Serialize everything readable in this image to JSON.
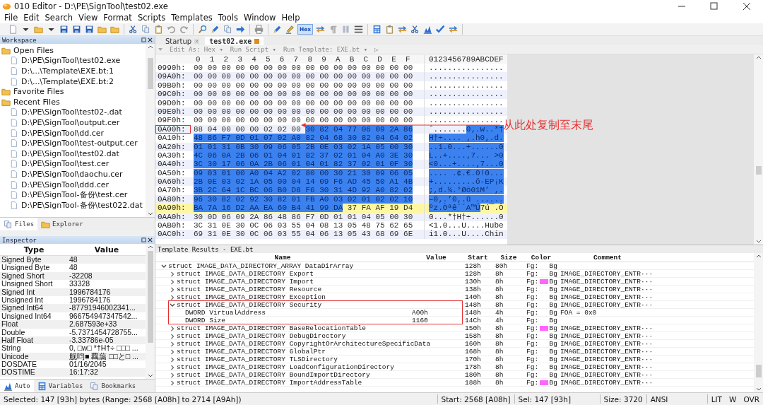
{
  "window": {
    "title": "010 Editor - D:\\PE\\SignTool\\test02.exe"
  },
  "menu": [
    "File",
    "Edit",
    "Search",
    "View",
    "Format",
    "Scripts",
    "Templates",
    "Tools",
    "Window",
    "Help"
  ],
  "toolbar": [
    [
      {
        "kind": "page"
      },
      {
        "kind": "caret"
      },
      {
        "kind": "folder"
      },
      {
        "kind": "caret"
      },
      {
        "kind": "disk"
      },
      {
        "kind": "disk"
      },
      {
        "kind": "disk"
      },
      {
        "kind": "folder"
      },
      {
        "kind": "folder"
      }
    ],
    [
      {
        "kind": "scissors"
      },
      {
        "kind": "pages"
      },
      {
        "kind": "clipboard"
      },
      {
        "kind": "undo"
      },
      {
        "kind": "redo"
      }
    ],
    [
      {
        "kind": "search"
      },
      {
        "kind": "pen"
      },
      {
        "kind": "pages"
      },
      {
        "kind": "arrow"
      }
    ],
    [
      {
        "kind": "printer"
      }
    ],
    [
      {
        "kind": "pen"
      },
      {
        "kind": "highlighter"
      },
      {
        "kind": "text",
        "label": "Hex",
        "selected": true
      },
      {
        "kind": "arrows"
      },
      {
        "kind": "paragraph"
      },
      {
        "kind": "columns"
      },
      {
        "kind": "grid"
      }
    ],
    [
      {
        "kind": "calculator"
      },
      {
        "kind": "clipboard"
      },
      {
        "kind": "arrows"
      },
      {
        "kind": "scissors"
      },
      {
        "kind": "chart"
      },
      {
        "kind": "check"
      },
      {
        "kind": "arrows"
      }
    ]
  ],
  "workspace": {
    "title": "Workspace",
    "groups": [
      {
        "label": "Open Files",
        "children": [
          {
            "label": "D:\\PE\\SignTool\\test02.exe"
          },
          {
            "label": "D:\\...\\Template\\EXE.bt:1"
          },
          {
            "label": "D:\\...\\Template\\EXE.bt:2"
          }
        ]
      },
      {
        "label": "Favorite Files"
      },
      {
        "label": "Recent Files",
        "children": [
          {
            "label": "D:\\PE\\SignTool\\test02-.dat"
          },
          {
            "label": "D:\\PE\\SignTool\\output.cer"
          },
          {
            "label": "D:\\PE\\SignTool\\dd.cer"
          },
          {
            "label": "D:\\PE\\SignTool\\test-output.cer"
          },
          {
            "label": "D:\\PE\\SignTool\\test02.dat"
          },
          {
            "label": "D:\\PE\\SignTool\\test.cer"
          },
          {
            "label": "D:\\PE\\SignTool\\daochu.cer"
          },
          {
            "label": "D:\\PE\\SignTool\\ddd.cer"
          },
          {
            "label": "D:\\PE\\SignTool-备份\\test.cer"
          },
          {
            "label": "D:\\PE\\SignTool-备份\\test022.dat"
          }
        ]
      }
    ],
    "tabs": [
      {
        "label": "Files",
        "selected": true
      },
      {
        "label": "Explorer",
        "selected": false
      }
    ]
  },
  "inspector": {
    "title": "Inspector",
    "columns": [
      "Type",
      "Value"
    ],
    "rows": [
      {
        "type": "Signed Byte",
        "value": "48"
      },
      {
        "type": "Unsigned Byte",
        "value": "48"
      },
      {
        "type": "Signed Short",
        "value": "-32208"
      },
      {
        "type": "Unsigned Short",
        "value": "33328"
      },
      {
        "type": "Signed Int",
        "value": "1996784176"
      },
      {
        "type": "Unsigned Int",
        "value": "1996784176"
      },
      {
        "type": "Signed Int64",
        "value": "-87791946002341..."
      },
      {
        "type": "Unsigned Int64",
        "value": "966754947347542..."
      },
      {
        "type": "Float",
        "value": "2.687593e+33"
      },
      {
        "type": "Double",
        "value": "-5.7371454728755..."
      },
      {
        "type": "Half Float",
        "value": "-3.33786e-05"
      },
      {
        "type": "String",
        "value": "0, □w□ *†H†÷ □□□ ..."
      },
      {
        "type": "Unicode",
        "value": "舰呁■ 覊藹 □□と□ ..."
      },
      {
        "type": "DOSDATE",
        "value": "01/16/2045"
      },
      {
        "type": "DOSTIME",
        "value": "16:17:32"
      }
    ],
    "tabs": [
      {
        "label": "Auto",
        "selected": true
      },
      {
        "label": "Variables",
        "selected": false
      },
      {
        "label": "Bookmarks",
        "selected": false
      }
    ]
  },
  "editor": {
    "tabs": [
      {
        "label": "Startup",
        "selected": false
      },
      {
        "label": "test02.exe",
        "selected": true
      }
    ],
    "toolbar": [
      "Edit As: Hex ▾",
      "Run Script ▾",
      "Run Template: EXE.bt ▾",
      "▷"
    ],
    "columns": [
      "0",
      "1",
      "2",
      "3",
      "4",
      "5",
      "6",
      "7",
      "8",
      "9",
      "A",
      "B",
      "C",
      "D",
      "E",
      "F"
    ],
    "ascii_header": "0123456789ABCDEF",
    "rows": [
      {
        "offset": "0990h:",
        "current": false,
        "boxed": false,
        "bytes": [
          {
            "text": "00 00 00 00 00 00 00 00 00 00 00 00 00 00 00 00",
            "selected": false
          }
        ],
        "ascii": [
          {
            "text": "................",
            "selected": false
          }
        ]
      },
      {
        "offset": "09A0h:",
        "current": false,
        "boxed": false,
        "bytes": [
          {
            "text": "00 00 00 00 00 00 00 00 00 00 00 00 00 00 00 00",
            "selected": false
          }
        ],
        "ascii": [
          {
            "text": "................",
            "selected": false
          }
        ]
      },
      {
        "offset": "09B0h:",
        "current": false,
        "boxed": false,
        "bytes": [
          {
            "text": "00 00 00 00 00 00 00 00 00 00 00 00 00 00 00 00",
            "selected": false
          }
        ],
        "ascii": [
          {
            "text": "................",
            "selected": false
          }
        ]
      },
      {
        "offset": "09C0h:",
        "current": false,
        "boxed": false,
        "bytes": [
          {
            "text": "00 00 00 00 00 00 00 00 00 00 00 00 00 00 00 00",
            "selected": false
          }
        ],
        "ascii": [
          {
            "text": "................",
            "selected": false
          }
        ]
      },
      {
        "offset": "09D0h:",
        "current": false,
        "boxed": false,
        "bytes": [
          {
            "text": "00 00 00 00 00 00 00 00 00 00 00 00 00 00 00 00",
            "selected": false
          }
        ],
        "ascii": [
          {
            "text": "................",
            "selected": false
          }
        ]
      },
      {
        "offset": "09E0h:",
        "current": false,
        "boxed": false,
        "bytes": [
          {
            "text": "00 00 00 00 00 00 00 00 00 00 00 00 00 00 00 00",
            "selected": false
          }
        ],
        "ascii": [
          {
            "text": "................",
            "selected": false
          }
        ]
      },
      {
        "offset": "09F0h:",
        "current": false,
        "boxed": false,
        "bytes": [
          {
            "text": "00 00 00 00 00 00 00 00 00 00 00 00 00 00 00 00",
            "selected": false
          }
        ],
        "ascii": [
          {
            "text": "................",
            "selected": false
          }
        ]
      },
      {
        "offset": "0A00h:",
        "current": false,
        "boxed": true,
        "bytes": [
          {
            "text": "88 04 00 00 00 02 02 00",
            "selected": false
          },
          {
            "text": "30 82 04 77 06 09 2A 86",
            "selected": true
          }
        ],
        "ascii": [
          {
            "text": "ˆ.......",
            "selected": false
          },
          {
            "text": "0‚.w..*†",
            "selected": true
          }
        ]
      },
      {
        "offset": "0A10h:",
        "current": false,
        "boxed": false,
        "bytes": [
          {
            "text": "48 86 F7 0D 01 07 02 A0 82 04 68 30 82 04 64 02",
            "selected": true
          }
        ],
        "ascii": [
          {
            "text": "H†÷.... ‚.h0‚.d.",
            "selected": true
          }
        ]
      },
      {
        "offset": "0A20h:",
        "current": false,
        "boxed": false,
        "bytes": [
          {
            "text": "01 01 31 0B 30 09 06 05 2B 0E 03 02 1A 05 00 30",
            "selected": true
          }
        ],
        "ascii": [
          {
            "text": "..1.0...+......0",
            "selected": true
          }
        ]
      },
      {
        "offset": "0A30h:",
        "current": false,
        "boxed": false,
        "bytes": [
          {
            "text": "4C 06 0A 2B 06 01 04 01 82 37 02 01 04 A0 3E 30",
            "selected": true
          }
        ],
        "ascii": [
          {
            "text": "L..+....‚7... >0",
            "selected": true
          }
        ]
      },
      {
        "offset": "0A40h:",
        "current": false,
        "boxed": false,
        "bytes": [
          {
            "text": "3C 30 17 06 0A 2B 06 01 04 01 82 37 02 01 0F 30",
            "selected": true
          }
        ],
        "ascii": [
          {
            "text": "<0...+....‚7...0",
            "selected": true
          }
        ]
      },
      {
        "offset": "0A50h:",
        "current": false,
        "boxed": false,
        "bytes": [
          {
            "text": "09 03 01 00 A0 04 A2 02 80 00 30 21 30 09 06 05",
            "selected": true
          }
        ],
        "ascii": [
          {
            "text": ".... .¢.€.0!0...",
            "selected": true
          }
        ]
      },
      {
        "offset": "0A60h:",
        "current": false,
        "boxed": false,
        "bytes": [
          {
            "text": "2B 0E 03 02 1A 05 00 04 14 09 F6 AD 45 50 A1 4B",
            "selected": true
          }
        ],
        "ascii": [
          {
            "text": "+.........ö-EP¡K",
            "selected": true
          }
        ]
      },
      {
        "offset": "0A70h:",
        "current": false,
        "boxed": false,
        "bytes": [
          {
            "text": "3B 2C 64 1C BC 06 B0 D8 F6 30 31 4D 92 A0 82 02",
            "selected": true
          }
        ],
        "ascii": [
          {
            "text": ";,d.¼.°Øö01M’ ‚.",
            "selected": true
          }
        ]
      },
      {
        "offset": "0A80h:",
        "current": false,
        "boxed": false,
        "bytes": [
          {
            "text": "96 30 82 02 92 30 82 01 FB A0 03 02 01 02 02 10",
            "selected": true
          }
        ],
        "ascii": [
          {
            "text": "–0‚.’0‚.û ......",
            "selected": true
          }
        ]
      },
      {
        "offset": "0A90h:",
        "current": true,
        "boxed": false,
        "bytes": [
          {
            "text": "BA 7A 16 D2 AA EA 60 B4 41 99 DA",
            "selected": true
          },
          {
            "text": "37 FA AF 19 D4",
            "selected": false
          }
        ],
        "ascii": [
          {
            "text": "ºz.Òªê`´A™Ú",
            "selected": true
          },
          {
            "text": "7ú¯.Ô",
            "selected": false
          }
        ]
      },
      {
        "offset": "0AA0h:",
        "current": false,
        "boxed": false,
        "bytes": [
          {
            "text": "30 0D 06 09 2A 86 48 86 F7 0D 01 01 04 05 00 30",
            "selected": false
          }
        ],
        "ascii": [
          {
            "text": "0...*†H†÷......0",
            "selected": false
          }
        ]
      },
      {
        "offset": "0AB0h:",
        "current": false,
        "boxed": false,
        "bytes": [
          {
            "text": "3C 31 0E 30 0C 06 03 55 04 08 13 05 48 75 62 65",
            "selected": false
          }
        ],
        "ascii": [
          {
            "text": "<1.0...U....Hube",
            "selected": false
          }
        ]
      },
      {
        "offset": "0AC0h:",
        "current": false,
        "boxed": false,
        "bytes": [
          {
            "text": "69 31 0E 30 0C 06 03 55 04 06 13 05 43 68 69 6E",
            "selected": false
          }
        ],
        "ascii": [
          {
            "text": "i1.0...U....Chin",
            "selected": false
          }
        ]
      }
    ],
    "annotation": "从此处复制至末尾"
  },
  "template": {
    "title": "Template Results - EXE.bt",
    "columns": [
      "Name",
      "Value",
      "Start",
      "Size",
      "Color",
      "Comment"
    ],
    "rows": [
      {
        "name": "struct IMAGE_DATA_DIRECTORY_ARRAY DataDirArray",
        "start": "128h",
        "size": "80h",
        "fg": "Fg:",
        "bg": "Bg",
        "expanded": true,
        "highlighted": false,
        "children": [
          {
            "name": "struct IMAGE_DATA_DIRECTORY Export",
            "start": "128h",
            "size": "8h",
            "fg": "Fg:",
            "bg": "Bg",
            "comment": "IMAGE_DIRECTORY_ENTR···",
            "expanded": false,
            "highlighted": false
          },
          {
            "name": "struct IMAGE_DATA_DIRECTORY Import",
            "start": "130h",
            "size": "8h",
            "fg": "Fg:",
            "bg": "Bg",
            "color": "#ff66ff",
            "comment": "IMAGE_DIRECTORY_ENTR···",
            "expanded": false,
            "highlighted": false
          },
          {
            "name": "struct IMAGE_DATA_DIRECTORY Resource",
            "start": "138h",
            "size": "8h",
            "fg": "Fg:",
            "bg": "Bg",
            "comment": "IMAGE_DIRECTORY_ENTR···",
            "expanded": false,
            "highlighted": false
          },
          {
            "name": "struct IMAGE_DATA_DIRECTORY Exception",
            "start": "140h",
            "size": "8h",
            "fg": "Fg:",
            "bg": "Bg",
            "comment": "IMAGE_DIRECTORY_ENTR···",
            "expanded": false,
            "highlighted": false
          },
          {
            "name": "struct IMAGE_DATA_DIRECTORY Security",
            "start": "148h",
            "size": "8h",
            "fg": "Fg:",
            "bg": "Bg",
            "comment": "IMAGE_DIRECTORY_ENTR···",
            "expanded": true,
            "highlighted": true,
            "children": [
              {
                "name": "DWORD VirtualAddress",
                "value": "A00h",
                "start": "148h",
                "size": "4h",
                "fg": "Fg:",
                "bg": "Bg",
                "comment": "FOA = 0x0",
                "highlighted": false
              },
              {
                "name": "DWORD Size",
                "value": "1160",
                "start": "14Ch",
                "size": "4h",
                "fg": "Fg:",
                "bg": "Bg",
                "highlighted": false
              }
            ]
          },
          {
            "name": "struct IMAGE_DATA_DIRECTORY BaseRelocationTable",
            "start": "150h",
            "size": "8h",
            "fg": "Fg:",
            "bg": "Bg",
            "color": "#ff66ff",
            "comment": "IMAGE_DIRECTORY_ENTR···",
            "expanded": false,
            "highlighted": false
          },
          {
            "name": "struct IMAGE_DATA_DIRECTORY DebugDirectory",
            "start": "158h",
            "size": "8h",
            "fg": "Fg:",
            "bg": "Bg",
            "comment": "IMAGE_DIRECTORY_ENTR···",
            "expanded": false,
            "highlighted": false
          },
          {
            "name": "struct IMAGE_DATA_DIRECTORY CopyrightOrArchitectureSpecificData",
            "start": "160h",
            "size": "8h",
            "fg": "Fg:",
            "bg": "Bg",
            "comment": "IMAGE_DIRECTORY_ENTR···",
            "expanded": false,
            "highlighted": false
          },
          {
            "name": "struct IMAGE_DATA_DIRECTORY GlobalPtr",
            "start": "168h",
            "size": "8h",
            "fg": "Fg:",
            "bg": "Bg",
            "comment": "IMAGE_DIRECTORY_ENTR···",
            "expanded": false,
            "highlighted": false
          },
          {
            "name": "struct IMAGE_DATA_DIRECTORY TLSDirectory",
            "start": "170h",
            "size": "8h",
            "fg": "Fg:",
            "bg": "Bg",
            "comment": "IMAGE_DIRECTORY_ENTR···",
            "expanded": false,
            "highlighted": false
          },
          {
            "name": "struct IMAGE_DATA_DIRECTORY LoadConfigurationDirectory",
            "start": "178h",
            "size": "8h",
            "fg": "Fg:",
            "bg": "Bg",
            "comment": "IMAGE_DIRECTORY_ENTR···",
            "expanded": false,
            "highlighted": false
          },
          {
            "name": "struct IMAGE_DATA_DIRECTORY BoundImportDirectory",
            "start": "180h",
            "size": "8h",
            "fg": "Fg:",
            "bg": "Bg",
            "comment": "IMAGE_DIRECTORY_ENTR···",
            "expanded": false,
            "highlighted": false
          },
          {
            "name": "struct IMAGE_DATA_DIRECTORY ImportAddressTable",
            "start": "188h",
            "size": "8h",
            "fg": "Fg:",
            "bg": "Bg",
            "color": "#ff66ff",
            "comment": "IMAGE_DIRECTORY_ENTR···",
            "expanded": false,
            "highlighted": false
          }
        ]
      }
    ]
  },
  "status_bar": {
    "selection": "Selected: 147 [93h] bytes (Range: 2568 [A08h] to 2714 [A9Ah])",
    "start": "Start: 2568 [A08h]",
    "sel": "Sel: 147 [93h]",
    "size": "Size: 3720",
    "encoding": "ANSI",
    "byte_order": "LIT",
    "write_mode": "W",
    "insert_mode": "OVR"
  }
}
